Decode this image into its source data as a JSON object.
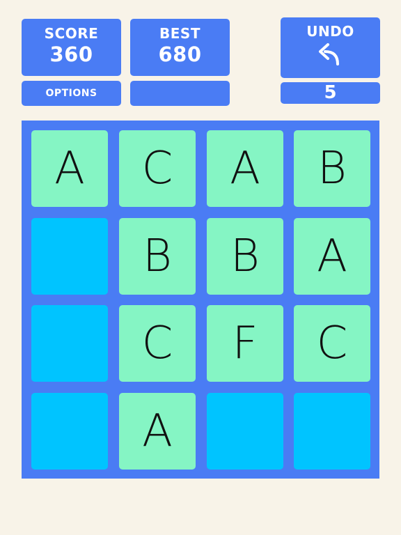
{
  "score": {
    "label": "SCORE",
    "value": "360"
  },
  "best": {
    "label": "BEST",
    "value": "680"
  },
  "options": {
    "label": "OPTIONS"
  },
  "undo": {
    "label": "UNDO",
    "count": "5",
    "icon": "undo-arrow-icon"
  },
  "colors": {
    "background": "#f8f3e8",
    "panel": "#4a7cf4",
    "board": "#4a7cf4",
    "tile_empty": "#00c4ff",
    "tile_filled": "#85f5c4",
    "tile_text": "#111111"
  },
  "board": {
    "rows": [
      [
        "A",
        "C",
        "A",
        "B"
      ],
      [
        "",
        "B",
        "B",
        "A"
      ],
      [
        "",
        "C",
        "F",
        "C"
      ],
      [
        "",
        "A",
        "",
        ""
      ]
    ]
  }
}
